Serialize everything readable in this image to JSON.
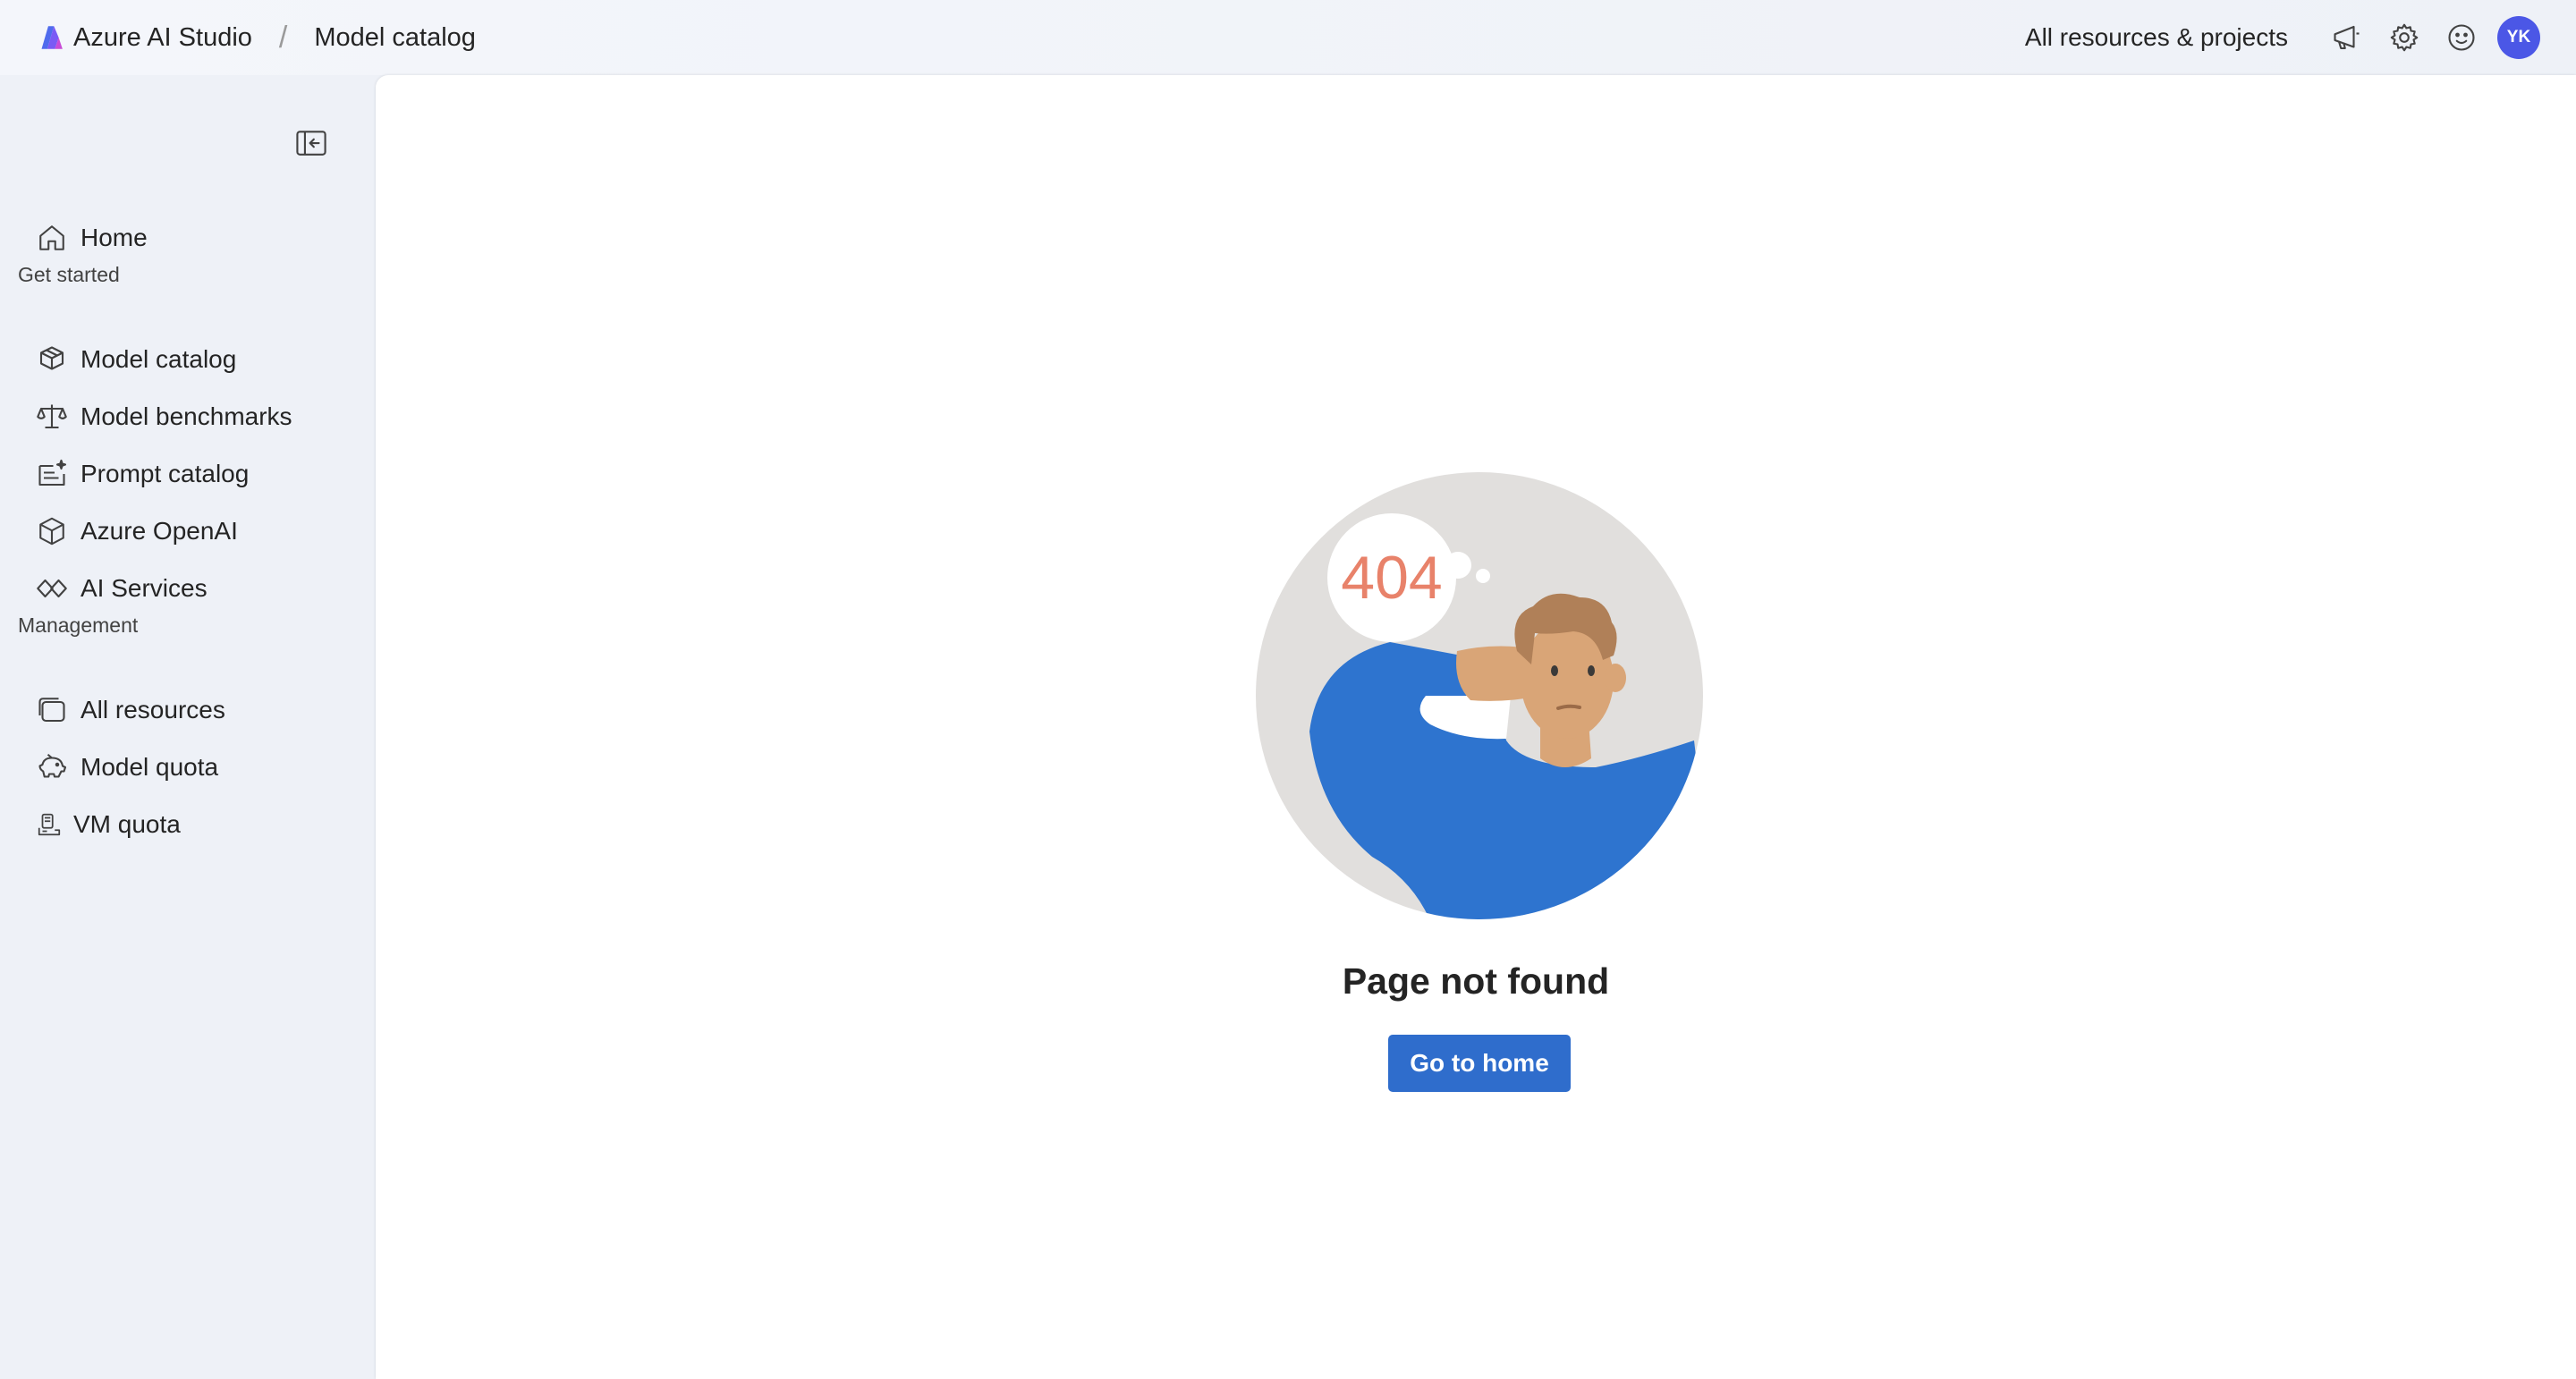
{
  "topbar": {
    "app_name": "Azure AI Studio",
    "separator": "/",
    "current_page": "Model catalog",
    "resources_link": "All resources & projects",
    "icons": [
      "megaphone-icon",
      "gear-icon",
      "smiley-icon"
    ],
    "avatar_initials": "YK",
    "avatar_color": "#4b57e6"
  },
  "sidebar": {
    "collapse_icon": "sidebar-collapse-icon",
    "home": {
      "label": "Home",
      "icon": "home-icon"
    },
    "get_started": {
      "heading": "Get started",
      "items": [
        {
          "label": "Model catalog",
          "icon": "cube-stack-icon"
        },
        {
          "label": "Model benchmarks",
          "icon": "scales-icon"
        },
        {
          "label": "Prompt catalog",
          "icon": "prompt-sparkle-icon"
        },
        {
          "label": "Azure OpenAI",
          "icon": "openai-cube-icon"
        },
        {
          "label": "AI Services",
          "icon": "diamonds-icon"
        }
      ]
    },
    "management": {
      "heading": "Management",
      "items": [
        {
          "label": "All resources",
          "icon": "stacked-windows-icon"
        },
        {
          "label": "Model quota",
          "icon": "piggy-bank-icon"
        },
        {
          "label": "VM quota",
          "icon": "vm-quota-icon"
        }
      ]
    }
  },
  "main": {
    "error_code": "404",
    "title": "Page not found",
    "button_label": "Go to home",
    "accent_color": "#2f6dcc"
  }
}
